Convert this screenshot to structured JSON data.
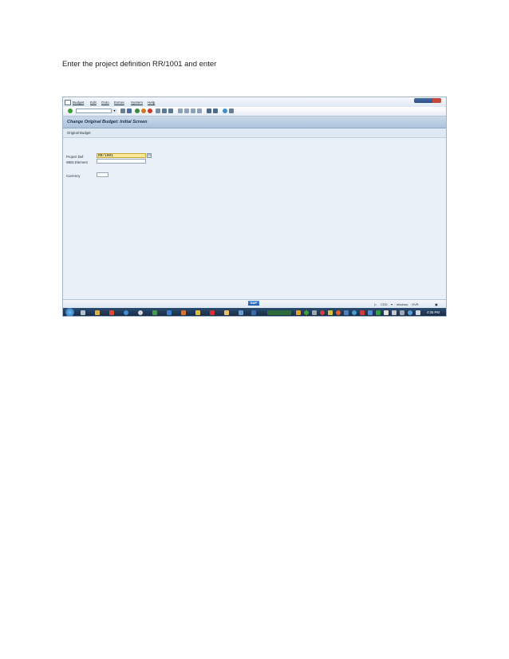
{
  "instruction": "Enter the project definition RR/1001 and enter",
  "menu": {
    "items": [
      "Budget",
      "Edit",
      "Goto",
      "Extras",
      "System",
      "Help"
    ]
  },
  "screen": {
    "title": "Change Original Budget: Initial Screen",
    "app_button": "Original Budget"
  },
  "fields": {
    "project_def": {
      "label": "Project Def.",
      "value": "RR/1001"
    },
    "wbs_element": {
      "label": "WBS Element",
      "value": ""
    },
    "currency": {
      "label": "Currency",
      "value": ""
    }
  },
  "status": {
    "logo": "SAP",
    "system": "CDD",
    "server": "sfvuksw",
    "mode": "OVR"
  },
  "taskbar": {
    "clock": "4:05 PM"
  },
  "colors": {
    "sap_background": "#e9f0f7",
    "title_bar": "#adc4dc",
    "focus_field": "#fbe99a",
    "taskbar": "#15283f"
  }
}
